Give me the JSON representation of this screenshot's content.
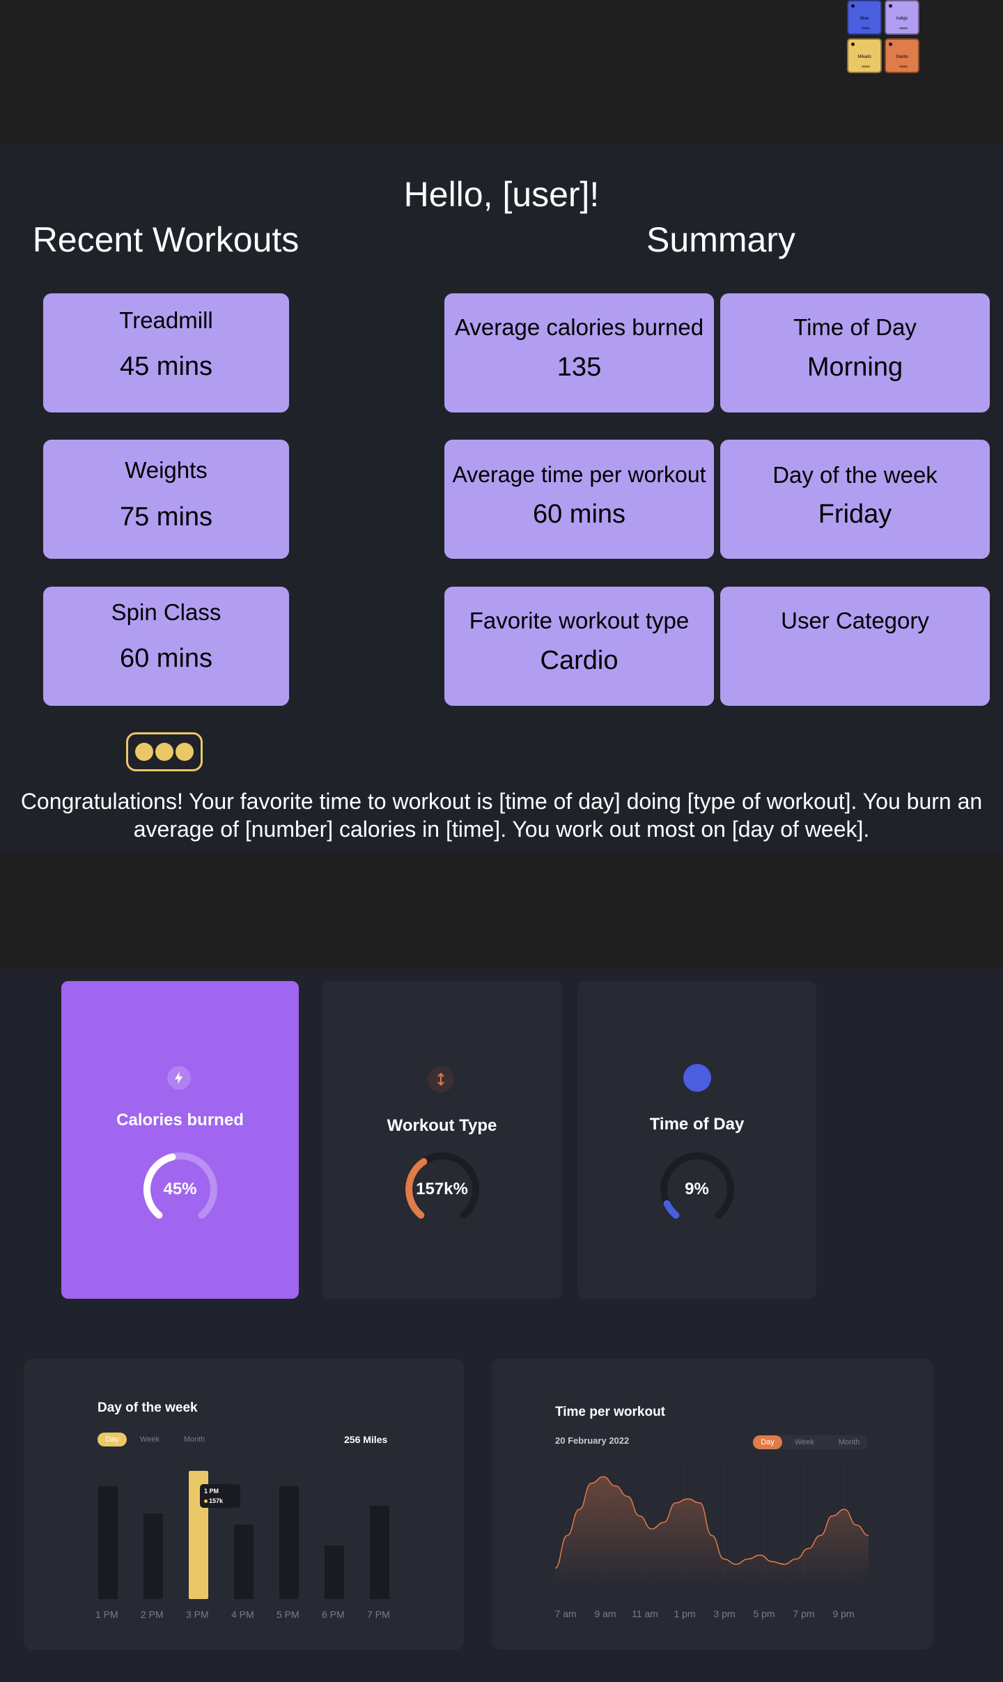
{
  "swatches": [
    {
      "name": "Blue",
      "color": "#4b5ee0"
    },
    {
      "name": "Indigo",
      "color": "#b19ef0"
    },
    {
      "name": "Mikado",
      "color": "#ebc867"
    },
    {
      "name": "Giants",
      "color": "#e07b4a"
    }
  ],
  "greeting": "Hello, [user]!",
  "recent": {
    "heading": "Recent Workouts",
    "items": [
      {
        "name": "Treadmill",
        "duration": "45 mins"
      },
      {
        "name": "Weights",
        "duration": "75 mins"
      },
      {
        "name": "Spin Class",
        "duration": "60 mins"
      }
    ]
  },
  "summary": {
    "heading": "Summary",
    "items": [
      {
        "label": "Average calories burned",
        "value": "135"
      },
      {
        "label": "Time of Day",
        "value": "Morning"
      },
      {
        "label": "Average time per workout",
        "value": "60 mins"
      },
      {
        "label": "Day of the week",
        "value": "Friday"
      },
      {
        "label": "Favorite workout type",
        "value": "Cardio"
      },
      {
        "label": "User Category",
        "value": ""
      }
    ]
  },
  "more_icon": "more-dots-icon",
  "congrats": "Congratulations! Your favorite time to workout is [time of day] doing [type of workout]. You burn an average of [number] calories in [time]. You work out most on [day of week].",
  "stats": [
    {
      "label": "Calories burned",
      "value": "45%",
      "progress": 0.45,
      "icon": "lightning-icon",
      "accent": "#ffffff",
      "card_bg": "#a066f0"
    },
    {
      "label": "Workout Type",
      "value": "157k%",
      "progress": 0.38,
      "icon": "up-down-arrow-icon",
      "accent": "#e07b4a",
      "card_bg": "#272933"
    },
    {
      "label": "Time of Day",
      "value": "9%",
      "progress": 0.09,
      "icon": "circle-icon",
      "accent": "#4b5ee0",
      "card_bg": "#272933"
    }
  ],
  "day_panel": {
    "title": "Day of the week",
    "tabs": [
      "Day",
      "Week",
      "Month"
    ],
    "active_tab": "Day",
    "total": "256 Miles",
    "tooltip": {
      "time": "1 PM",
      "value": "157k"
    },
    "chart_data": {
      "type": "bar",
      "categories": [
        "1 PM",
        "2 PM",
        "3 PM",
        "4 PM",
        "5 PM",
        "6 PM",
        "7 PM"
      ],
      "values": [
        0.88,
        0.67,
        1.0,
        0.58,
        0.88,
        0.42,
        0.73
      ],
      "highlight_index": 2,
      "accent": "#ebc867"
    }
  },
  "time_panel": {
    "title": "Time per workout",
    "date": "20 February 2022",
    "tabs": [
      "Day",
      "Week",
      "Month"
    ],
    "active_tab": "Day",
    "chart_data": {
      "type": "area",
      "x": [
        "7 am",
        "9 am",
        "11 am",
        "1 pm",
        "3 pm",
        "5 pm",
        "7 pm",
        "9 pm"
      ],
      "values": [
        5,
        30,
        50,
        70,
        75,
        68,
        60,
        45,
        35,
        40,
        55,
        58,
        55,
        30,
        12,
        8,
        12,
        15,
        10,
        8,
        12,
        20,
        30,
        45,
        50,
        38,
        30
      ],
      "accent": "#e07b4a"
    }
  }
}
